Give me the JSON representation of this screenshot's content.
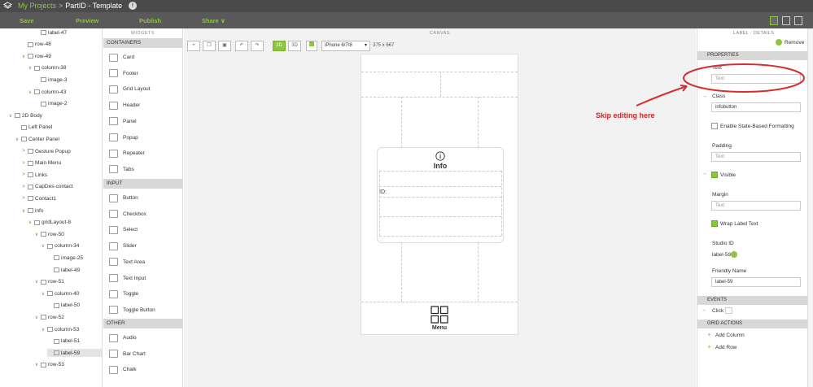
{
  "title": {
    "project": "My Projects",
    "separator": ">",
    "page": "PartID - Template",
    "info_icon": "info-icon"
  },
  "toolbar": {
    "save": "Save",
    "preview": "Preview",
    "publish": "Publish",
    "share": "Share ∨"
  },
  "tree": {
    "items": [
      {
        "label": "label-47",
        "indent": 5,
        "icon": "label",
        "toggle": ""
      },
      {
        "label": "row-48",
        "indent": 3,
        "icon": "row",
        "toggle": ""
      },
      {
        "label": "row-49",
        "indent": 3,
        "icon": "row",
        "toggle": "∨"
      },
      {
        "label": "column-38",
        "indent": 4,
        "icon": "column",
        "toggle": "∨"
      },
      {
        "label": "image-3",
        "indent": 5,
        "icon": "image",
        "toggle": ""
      },
      {
        "label": "column-43",
        "indent": 4,
        "icon": "column",
        "toggle": "∨"
      },
      {
        "label": "image-2",
        "indent": 5,
        "icon": "image",
        "toggle": ""
      },
      {
        "label": "2D Body",
        "indent": 1,
        "icon": "body",
        "toggle": "∨"
      },
      {
        "label": "Left Panel",
        "indent": 2,
        "icon": "panel",
        "toggle": ""
      },
      {
        "label": "Center Panel",
        "indent": 2,
        "icon": "panel",
        "toggle": "∨"
      },
      {
        "label": "Gesture Popup",
        "indent": 3,
        "icon": "popup",
        "toggle": ">"
      },
      {
        "label": "Main Menu",
        "indent": 3,
        "icon": "popup",
        "toggle": ">"
      },
      {
        "label": "Links",
        "indent": 3,
        "icon": "popup",
        "toggle": ">"
      },
      {
        "label": "CapDes-contact",
        "indent": 3,
        "icon": "popup",
        "toggle": ">"
      },
      {
        "label": "Contact1",
        "indent": 3,
        "icon": "popup",
        "toggle": ">"
      },
      {
        "label": "info",
        "indent": 3,
        "icon": "popup",
        "toggle": "∨"
      },
      {
        "label": "gridLayout-8",
        "indent": 4,
        "icon": "grid",
        "toggle": "∨"
      },
      {
        "label": "row-50",
        "indent": 5,
        "icon": "row",
        "toggle": "∨"
      },
      {
        "label": "column-34",
        "indent": 6,
        "icon": "column",
        "toggle": "∨"
      },
      {
        "label": "image-25",
        "indent": 7,
        "icon": "image",
        "toggle": ""
      },
      {
        "label": "label-49",
        "indent": 7,
        "icon": "label",
        "toggle": ""
      },
      {
        "label": "row-51",
        "indent": 5,
        "icon": "row",
        "toggle": "∨"
      },
      {
        "label": "column-40",
        "indent": 6,
        "icon": "column",
        "toggle": "∨"
      },
      {
        "label": "label-50",
        "indent": 7,
        "icon": "label",
        "toggle": ""
      },
      {
        "label": "row-52",
        "indent": 5,
        "icon": "row",
        "toggle": "∨"
      },
      {
        "label": "column-53",
        "indent": 6,
        "icon": "column",
        "toggle": "∨"
      },
      {
        "label": "label-51",
        "indent": 7,
        "icon": "label",
        "toggle": ""
      },
      {
        "label": "label-59",
        "indent": 7,
        "icon": "label",
        "toggle": "",
        "selected": true
      },
      {
        "label": "row-53",
        "indent": 5,
        "icon": "row",
        "toggle": "∨"
      }
    ]
  },
  "widgets": {
    "header": "WIDGETS",
    "containers_head": "CONTAINERS",
    "containers": [
      {
        "label": "Card",
        "icon": "card-icon"
      },
      {
        "label": "Footer",
        "icon": "footer-icon"
      },
      {
        "label": "Grid Layout",
        "icon": "grid-layout-icon"
      },
      {
        "label": "Header",
        "icon": "header-icon"
      },
      {
        "label": "Panel",
        "icon": "panel-icon"
      },
      {
        "label": "Popup",
        "icon": "popup-icon"
      },
      {
        "label": "Repeater",
        "icon": "repeater-icon"
      },
      {
        "label": "Tabs",
        "icon": "tabs-icon"
      }
    ],
    "input_head": "INPUT",
    "inputs": [
      {
        "label": "Button",
        "icon": "button-icon"
      },
      {
        "label": "Checkbox",
        "icon": "checkbox-icon"
      },
      {
        "label": "Select",
        "icon": "select-icon"
      },
      {
        "label": "Slider",
        "icon": "slider-icon"
      },
      {
        "label": "Text Area",
        "icon": "text-area-icon"
      },
      {
        "label": "Text Input",
        "icon": "text-input-icon"
      },
      {
        "label": "Toggle",
        "icon": "toggle-icon"
      },
      {
        "label": "Toggle Button",
        "icon": "toggle-button-icon"
      }
    ],
    "other_head": "OTHER",
    "other": [
      {
        "label": "Audio",
        "icon": "audio-icon"
      },
      {
        "label": "Bar Chart",
        "icon": "bar-chart-icon"
      },
      {
        "label": "Chalk",
        "icon": "chalk-icon"
      }
    ]
  },
  "canvas": {
    "header": "CANVAS",
    "mode_2d": "2D",
    "mode_3d": "3D",
    "device": "iPhone 6/7/8",
    "dropdown_arrow": "▾",
    "resolution": "375 x 667",
    "popup": {
      "title": "Info",
      "id_label": "ID:"
    },
    "menu_label": "Menu"
  },
  "right_panel": {
    "header": "LABEL · DETAILS",
    "remove": "Remove",
    "properties_head": "PROPERTIES",
    "text_label": "Text",
    "text_placeholder": "Text",
    "class_label": "Class",
    "class_value": "infobutton",
    "state_formatting": "Enable State-Based Formatting",
    "padding_label": "Padding",
    "padding_placeholder": "Text",
    "visible_label": "Visible",
    "margin_label": "Margin",
    "margin_placeholder": "Text",
    "wrap_label": "Wrap Label Text",
    "studio_id_label": "Studio ID",
    "studio_id_value": "label-59",
    "friendly_name_label": "Friendly Name",
    "friendly_name_value": "label-59",
    "events_head": "EVENTS",
    "click_label": "Click",
    "grid_actions_head": "GRID ACTIONS",
    "add_column": "Add Column",
    "add_row": "Add Row"
  },
  "annotation": {
    "text": "Skip editing here",
    "color": "#c62828"
  },
  "colors": {
    "accent": "#8cc63f",
    "titlebar": "#4b4b4b",
    "toolbar": "#595959"
  }
}
